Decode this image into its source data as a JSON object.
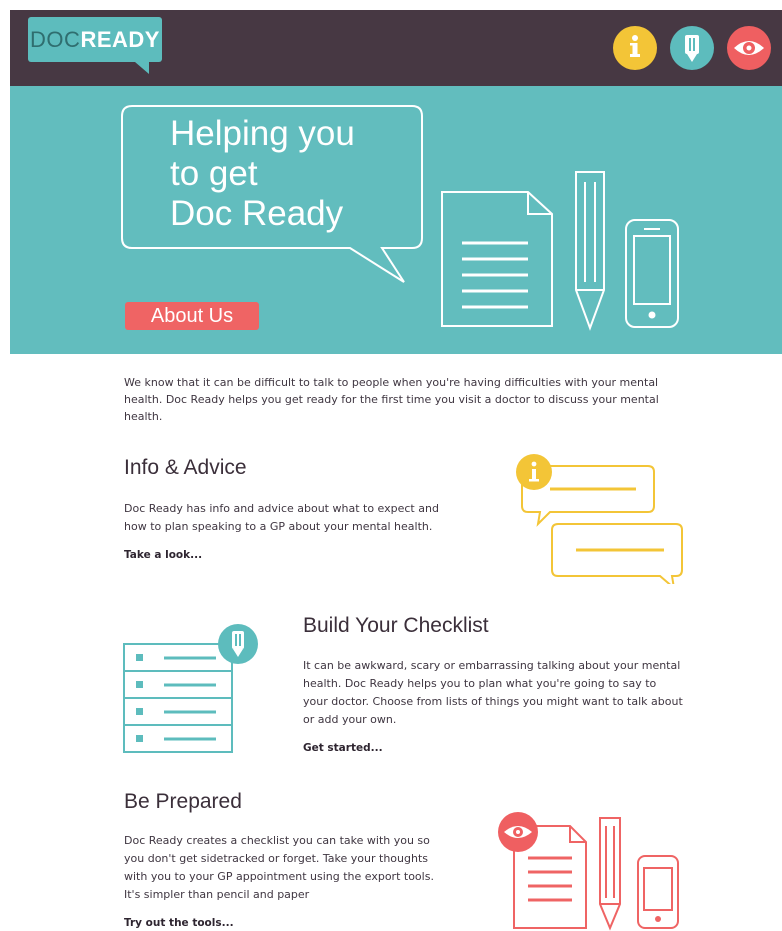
{
  "header": {
    "logo": {
      "doc": "DOC",
      "ready": "READY"
    },
    "nav": [
      {
        "name": "info",
        "color": "#f3c537"
      },
      {
        "name": "checklist",
        "color": "#5dbcbd"
      },
      {
        "name": "eye",
        "color": "#ef5f61"
      }
    ]
  },
  "hero": {
    "title_lines": [
      "Helping you",
      "to get",
      "Doc Ready"
    ],
    "about_button": "About Us",
    "background": "#62bdbe"
  },
  "intro": "We know that it can be difficult to talk to people when you're having difficulties with your mental health. Doc Ready helps you get ready for the first time you visit a doctor to discuss your mental health.",
  "sections": [
    {
      "title": "Info & Advice",
      "text": "Doc Ready has info and advice about what to expect and how to plan speaking to a GP about your mental health.",
      "link": "Take a look...",
      "accent": "#f3c537"
    },
    {
      "title": "Build Your Checklist",
      "text": "It can be awkward, scary or embarrassing talking about your mental health. Doc Ready helps you to plan what you're going to say to your doctor. Choose from lists of things you might want to talk about or add your own.",
      "link": "Get started...",
      "accent": "#5dbcbd"
    },
    {
      "title": "Be Prepared",
      "text": "Doc Ready creates a checklist you can take with you so you don't get sidetracked or forget. Take your thoughts with you to your GP appointment using the export tools. It's simpler than pencil and paper",
      "link": "Try out the tools...",
      "accent": "#ef5f61"
    }
  ],
  "colors": {
    "header_bg": "#473843",
    "brand_teal": "#5dbcbd",
    "coral": "#ef6464",
    "yellow": "#f3c537"
  }
}
